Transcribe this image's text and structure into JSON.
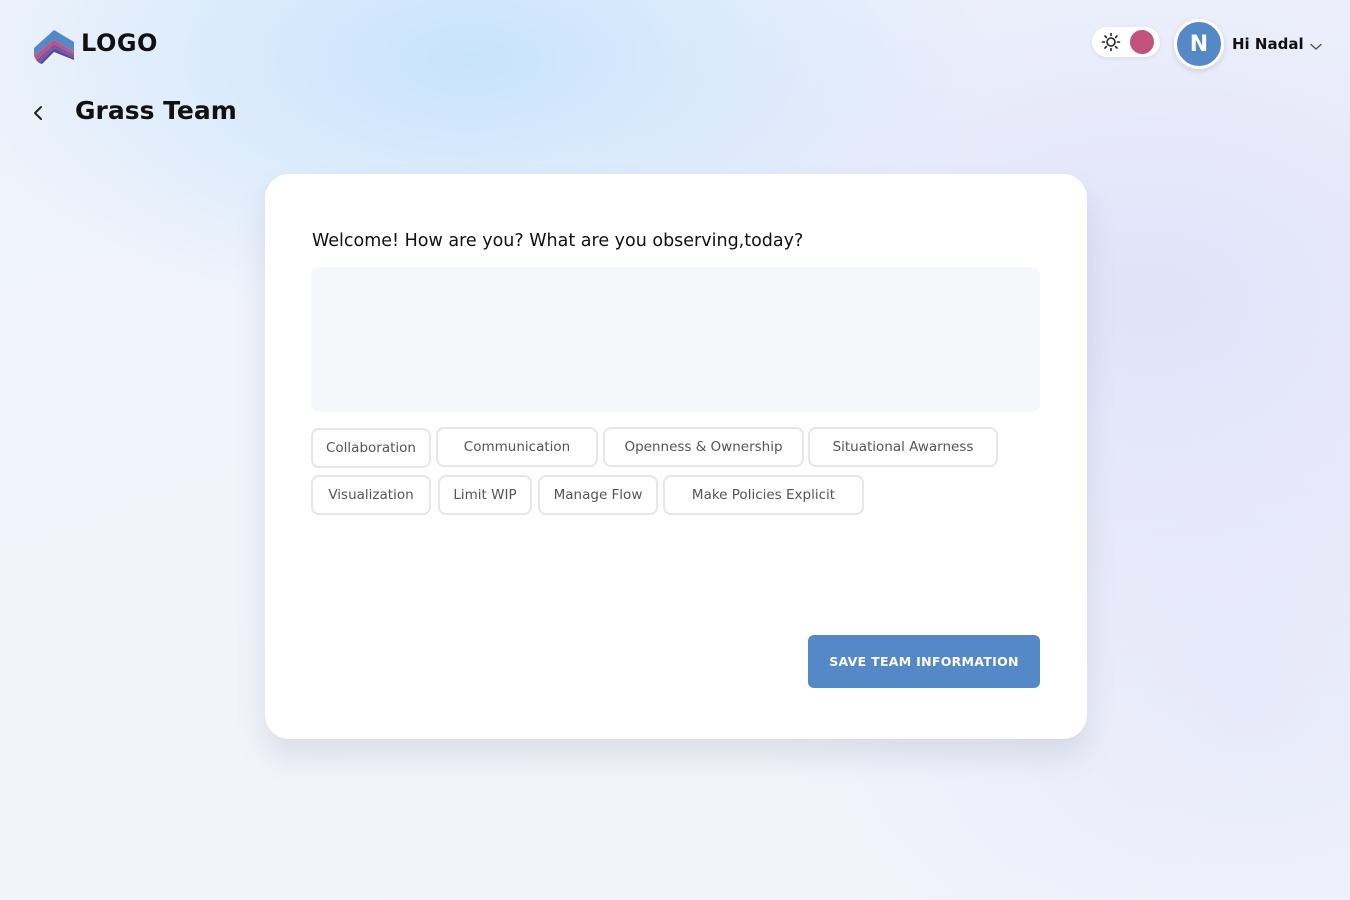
{
  "header": {
    "logo_text": "LOGO",
    "logo_icon": "stacked-chevron-logo-icon",
    "theme_toggle": {
      "icon": "sun-icon",
      "knob_color": "#c2527c"
    },
    "user": {
      "avatar_initial": "N",
      "greeting": "Hi Nadal",
      "menu_icon": "chevron-down-icon"
    }
  },
  "page": {
    "back_icon": "chevron-left-icon",
    "title": "Grass Team"
  },
  "form": {
    "question": "Welcome! How are you? What are you observing,today?",
    "observation_value": "",
    "tags": [
      "Collaboration",
      "Communication",
      "Openness & Ownership",
      "Situational Awarness",
      "Visualization",
      "Limit WIP",
      "Manage Flow",
      "Make Policies Explicit"
    ],
    "save_label": "SAVE TEAM INFORMATION"
  },
  "colors": {
    "accent": "#5488c7",
    "toggle_knob": "#c2527c",
    "input_bg": "#f6f7fb",
    "tag_border": "#e6e7ea"
  }
}
